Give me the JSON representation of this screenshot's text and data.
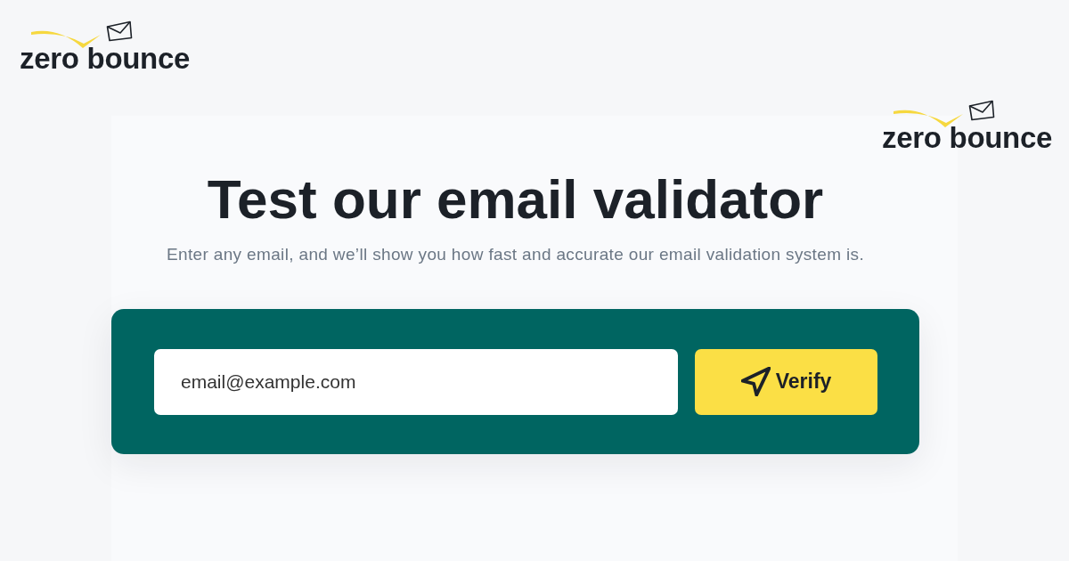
{
  "logos": [
    {
      "text": "zero bounce"
    },
    {
      "text": "zero bounce"
    }
  ],
  "heading": "Test our email validator",
  "subheading": "Enter any email, and we’ll show you how fast and accurate our email validation system is.",
  "form": {
    "email_field": {
      "value": "email@example.com"
    },
    "verify_button": {
      "label": "Verify"
    }
  }
}
